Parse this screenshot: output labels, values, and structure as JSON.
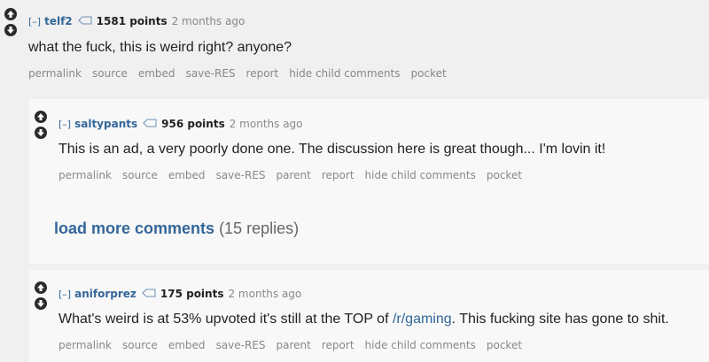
{
  "comments": [
    {
      "expand": "[–]",
      "author": "telf2",
      "score": "1581 points",
      "time": "2 months ago",
      "body": "what the fuck, this is weird right? anyone?",
      "buttons": [
        "permalink",
        "source",
        "embed",
        "save-RES",
        "report",
        "hide child comments",
        "pocket"
      ]
    },
    {
      "expand": "[–]",
      "author": "saltypants",
      "score": "956 points",
      "time": "2 months ago",
      "body": "This is an ad, a very poorly done one. The discussion here is great though... I'm lovin it!",
      "buttons": [
        "permalink",
        "source",
        "embed",
        "save-RES",
        "parent",
        "report",
        "hide child comments",
        "pocket"
      ]
    },
    {
      "expand": "[–]",
      "author": "aniforprez",
      "score": "175 points",
      "time": "2 months ago",
      "body_pre": "What's weird is at 53% upvoted it's still at the TOP of ",
      "body_link": "/r/gaming",
      "body_post": ". This fucking site has gone to shit.",
      "buttons": [
        "permalink",
        "source",
        "embed",
        "save-RES",
        "parent",
        "report",
        "hide child comments",
        "pocket"
      ]
    }
  ],
  "load_more": {
    "link": "load more comments",
    "count": "(15 replies)"
  }
}
